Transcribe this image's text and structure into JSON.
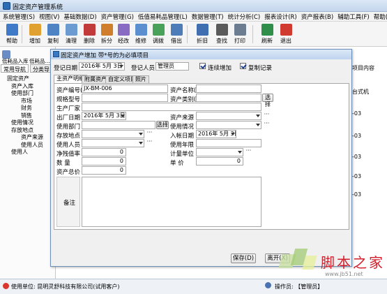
{
  "main_window": {
    "title": "固定资产管理系统"
  },
  "menubar": [
    "系统管理(S)",
    "视图(V)",
    "基础数据(D)",
    "资产管理(G)",
    "低值易耗品管理(L)",
    "数据管理(T)",
    "统计分析(C)",
    "报表设计(R)",
    "资产报表(B)",
    "辅助工具(F)",
    "帮助(H)"
  ],
  "toolbar": [
    {
      "label": "帮助",
      "icon": "help-book-icon",
      "color": "#3e7ac7"
    },
    {
      "label": "增加",
      "icon": "add-icon",
      "color": "#e0a131"
    },
    {
      "label": "复制",
      "icon": "copy-icon",
      "color": "#4f84c4"
    },
    {
      "label": "清理",
      "icon": "clear-icon",
      "color": "#6b9bd1"
    },
    {
      "label": "删除",
      "icon": "delete-icon",
      "color": "#c23b3b"
    },
    {
      "label": "拆分",
      "icon": "split-icon",
      "color": "#d07d2c"
    },
    {
      "label": "经改",
      "icon": "edit-icon",
      "color": "#8a6bc3"
    },
    {
      "label": "维修",
      "icon": "repair-icon",
      "color": "#5c8fcf"
    },
    {
      "label": "调拨",
      "icon": "transfer-icon",
      "color": "#4aa25a"
    },
    {
      "label": "借出",
      "icon": "lend-icon",
      "color": "#4d7cb8"
    },
    {
      "label": "折旧",
      "icon": "depreciation-icon",
      "color": "#3f6fb0"
    },
    {
      "label": "查找",
      "icon": "binoculars-icon",
      "color": "#5a5a5a"
    },
    {
      "label": "打印",
      "icon": "printer-icon",
      "color": "#6c7d92"
    },
    {
      "label": "刷新",
      "icon": "refresh-icon",
      "color": "#2f8e4a"
    },
    {
      "label": "退出",
      "icon": "exit-power-icon",
      "color": "#d03a2f"
    }
  ],
  "left_panel": {
    "top_labels": [
      "低耗品入库",
      "低耗品..."
    ],
    "tabs": [
      "常用导航",
      "分类导"
    ],
    "tree": [
      "固定资产",
      "资产入库",
      "使用部门",
      "市场",
      "财务",
      "销售",
      "使用情况",
      "存放地点",
      "资产来源",
      "使用人员",
      "使用人"
    ]
  },
  "right_grid": {
    "header": "项目内容",
    "cells": [
      "台式机",
      "-03",
      "-03",
      "-03",
      "-03",
      "-03"
    ]
  },
  "dialog": {
    "title": "固定资产增加 带*号的为必填项目",
    "reg_date_label": "登记日期",
    "reg_date_value": "2016年 5月 3日",
    "reg_person_label": "登记人员",
    "reg_person_value": "管理员",
    "continuous_add_label": "连续增加",
    "continuous_add_checked": true,
    "copy_record_label": "复制记录",
    "copy_record_checked": true,
    "tabs": [
      "主资产明细",
      "附属资产",
      "自定义项目",
      "照片"
    ],
    "fields": {
      "asset_code_label": "资产编号(*)",
      "asset_code_value": "JX-BM-006",
      "asset_name_label": "资产名称(*)",
      "asset_name_value": "",
      "spec_label": "规格型号",
      "spec_value": "",
      "category_label": "资产类别(*)",
      "category_value": "",
      "category_btn": "选择",
      "manufacturer_label": "生产厂家",
      "manufacturer_value": "",
      "factory_date_label": "出厂日期",
      "factory_date_value": "2016年 5月 3日",
      "source_label": "资产来源",
      "source_value": "",
      "dept_label": "使用部门",
      "dept_value": "",
      "dept_btn": "选择",
      "status_label": "使用情况",
      "status_value": "",
      "location_label": "存放地点",
      "location_value": "",
      "entry_date_label": "入帐日期",
      "entry_date_value": "2016年 5月 3日",
      "user_label": "使用人员",
      "user_value": "",
      "life_label": "使用年限",
      "life_value": "",
      "residual_rate_label": "净残值率",
      "residual_rate_value": "0",
      "unit_label": "计量单位",
      "unit_value": "",
      "quantity_label": "数  量",
      "quantity_value": "0",
      "price_label": "单  价",
      "price_value": "0",
      "total_label": "资产总价",
      "total_value": "0",
      "remark_label": "备注",
      "remark_value": ""
    },
    "save_btn": "保存(D)",
    "exit_btn": "离开(X)"
  },
  "statusbar": {
    "unit": "使用单位: 昆明灵舒科技有限公司(试用客户)",
    "operator": "操作员: 【管理员】"
  },
  "watermark": {
    "text": "脚本之家",
    "url": "www.jb51.net"
  }
}
